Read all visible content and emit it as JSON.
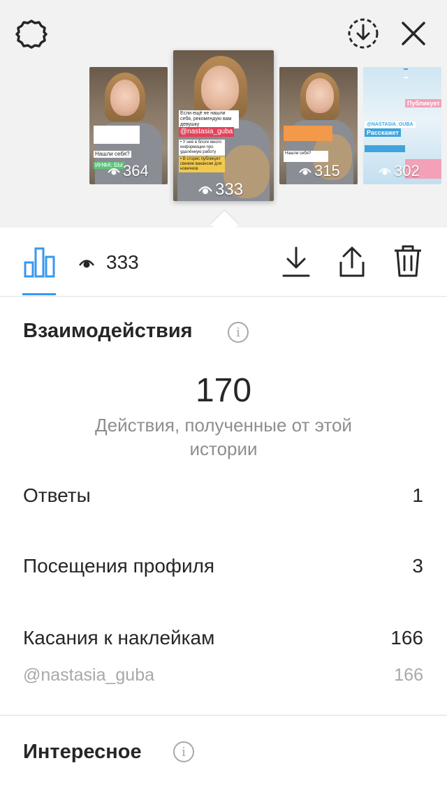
{
  "header": {
    "settings_icon": "gear-icon",
    "download_icon": "download-circle-icon",
    "close_icon": "close-icon"
  },
  "stories": [
    {
      "views": "364",
      "caption": "Нашли себя?",
      "caption2": "ИНФА: БЫ"
    },
    {
      "views": "333",
      "caption": "Если ещё не нашли себя, рекомендую вам девушку",
      "handle": "@nastasia_guba",
      "caption2": "• У неё в блоге много информации про удалённую работу",
      "caption3": "• В сторис публикует свежие вакансии для новичков"
    },
    {
      "views": "315",
      "caption": "Нашли себя?"
    },
    {
      "views": "302",
      "caption": "Расскажет",
      "caption2": "Публикует",
      "caption3": "@NASTASIA_GUBA"
    }
  ],
  "toolbar": {
    "insights_icon": "bar-chart-icon",
    "eye_icon": "eye-icon",
    "view_count": "333",
    "download_icon": "download-icon",
    "share_icon": "share-icon",
    "delete_icon": "trash-icon"
  },
  "interactions": {
    "title": "Взаимодействия",
    "total": "170",
    "total_caption": "Действия, полученные от этой истории",
    "rows": [
      {
        "label": "Ответы",
        "value": "1"
      },
      {
        "label": "Посещения профиля",
        "value": "3"
      },
      {
        "label": "Касания к наклейкам",
        "value": "166"
      }
    ],
    "sticker": {
      "label": "@nastasia_guba",
      "value": "166"
    }
  },
  "discovery": {
    "title": "Интересное"
  },
  "colors": {
    "accent": "#3897f0",
    "text": "#262626",
    "muted": "#8e8e8e",
    "header_bg": "#f2f2f2"
  }
}
